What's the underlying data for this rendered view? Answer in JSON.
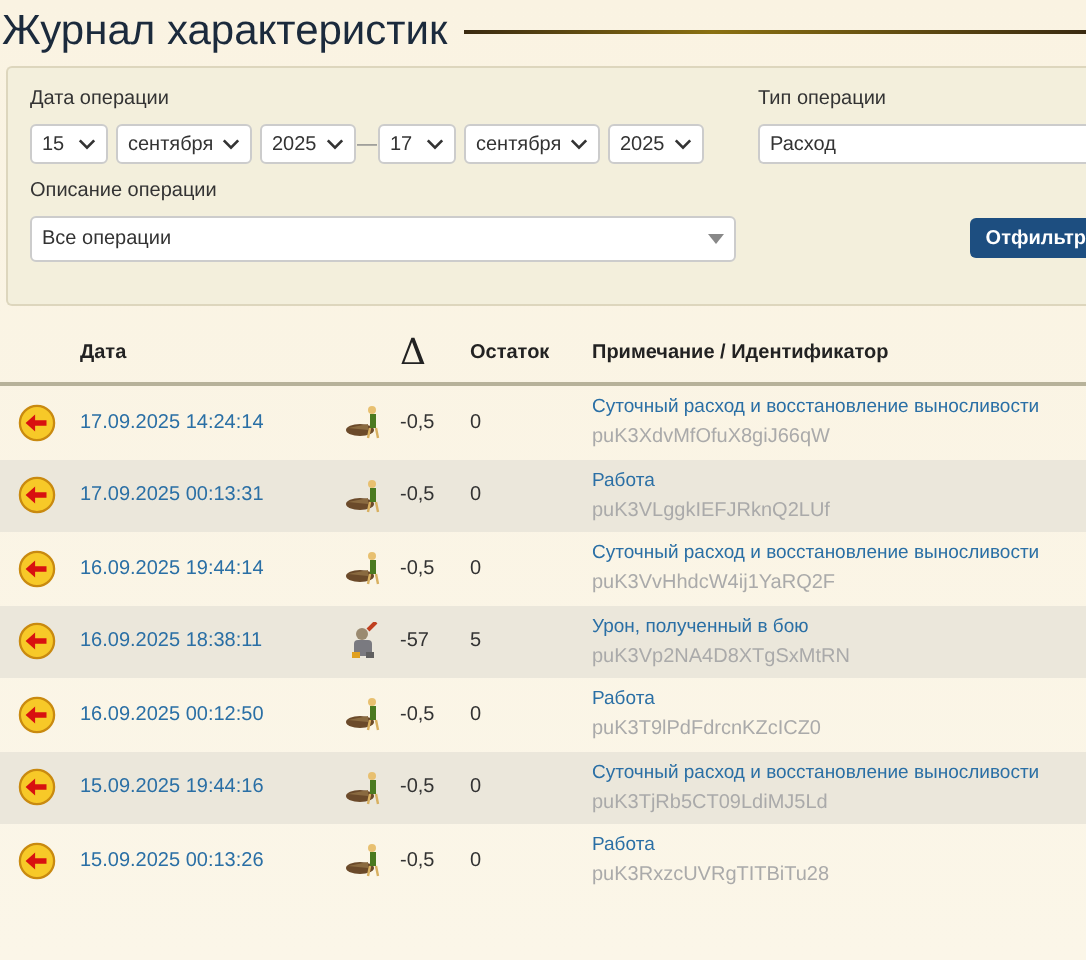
{
  "title": "Журнал характеристик",
  "filters": {
    "date_label": "Дата операции",
    "date_from": {
      "day": "15",
      "month": "сентября",
      "year": "2025"
    },
    "date_separator": "—",
    "date_to": {
      "day": "17",
      "month": "сентября",
      "year": "2025"
    },
    "type_label": "Тип операции",
    "type_value": "Расход",
    "description_label": "Описание операции",
    "description_value": "Все операции",
    "filter_button": "Отфильтр"
  },
  "table": {
    "columns": [
      "Дата",
      "Δ",
      "Остаток",
      "Примечание / Идентификатор"
    ],
    "rows": [
      {
        "date": "17.09.2025 14:24:14",
        "kind": "stamina",
        "delta": "-0,5",
        "remainder": "0",
        "note": "Суточный расход и восстановление выносливости",
        "id": "puK3XdvMfOfuX8giJ66qW"
      },
      {
        "date": "17.09.2025 00:13:31",
        "kind": "stamina",
        "delta": "-0,5",
        "remainder": "0",
        "note": "Работа",
        "id": "puK3VLggkIEFJRknQ2LUf"
      },
      {
        "date": "16.09.2025 19:44:14",
        "kind": "stamina",
        "delta": "-0,5",
        "remainder": "0",
        "note": "Суточный расход и восстановление выносливости",
        "id": "puK3VvHhdcW4ij1YaRQ2F"
      },
      {
        "date": "16.09.2025 18:38:11",
        "kind": "combat",
        "delta": "-57",
        "remainder": "5",
        "note": "Урон, полученный в бою",
        "id": "puK3Vp2NA4D8XTgSxMtRN"
      },
      {
        "date": "16.09.2025 00:12:50",
        "kind": "stamina",
        "delta": "-0,5",
        "remainder": "0",
        "note": "Работа",
        "id": "puK3T9lPdFdrcnKZcICZ0"
      },
      {
        "date": "15.09.2025 19:44:16",
        "kind": "stamina",
        "delta": "-0,5",
        "remainder": "0",
        "note": "Суточный расход и восстановление выносливости",
        "id": "puK3TjRb5CT09LdiMJ5Ld"
      },
      {
        "date": "15.09.2025 00:13:26",
        "kind": "stamina",
        "delta": "-0,5",
        "remainder": "0",
        "note": "Работа",
        "id": "puK3RxzcUVRgTITBiTu28"
      }
    ]
  }
}
